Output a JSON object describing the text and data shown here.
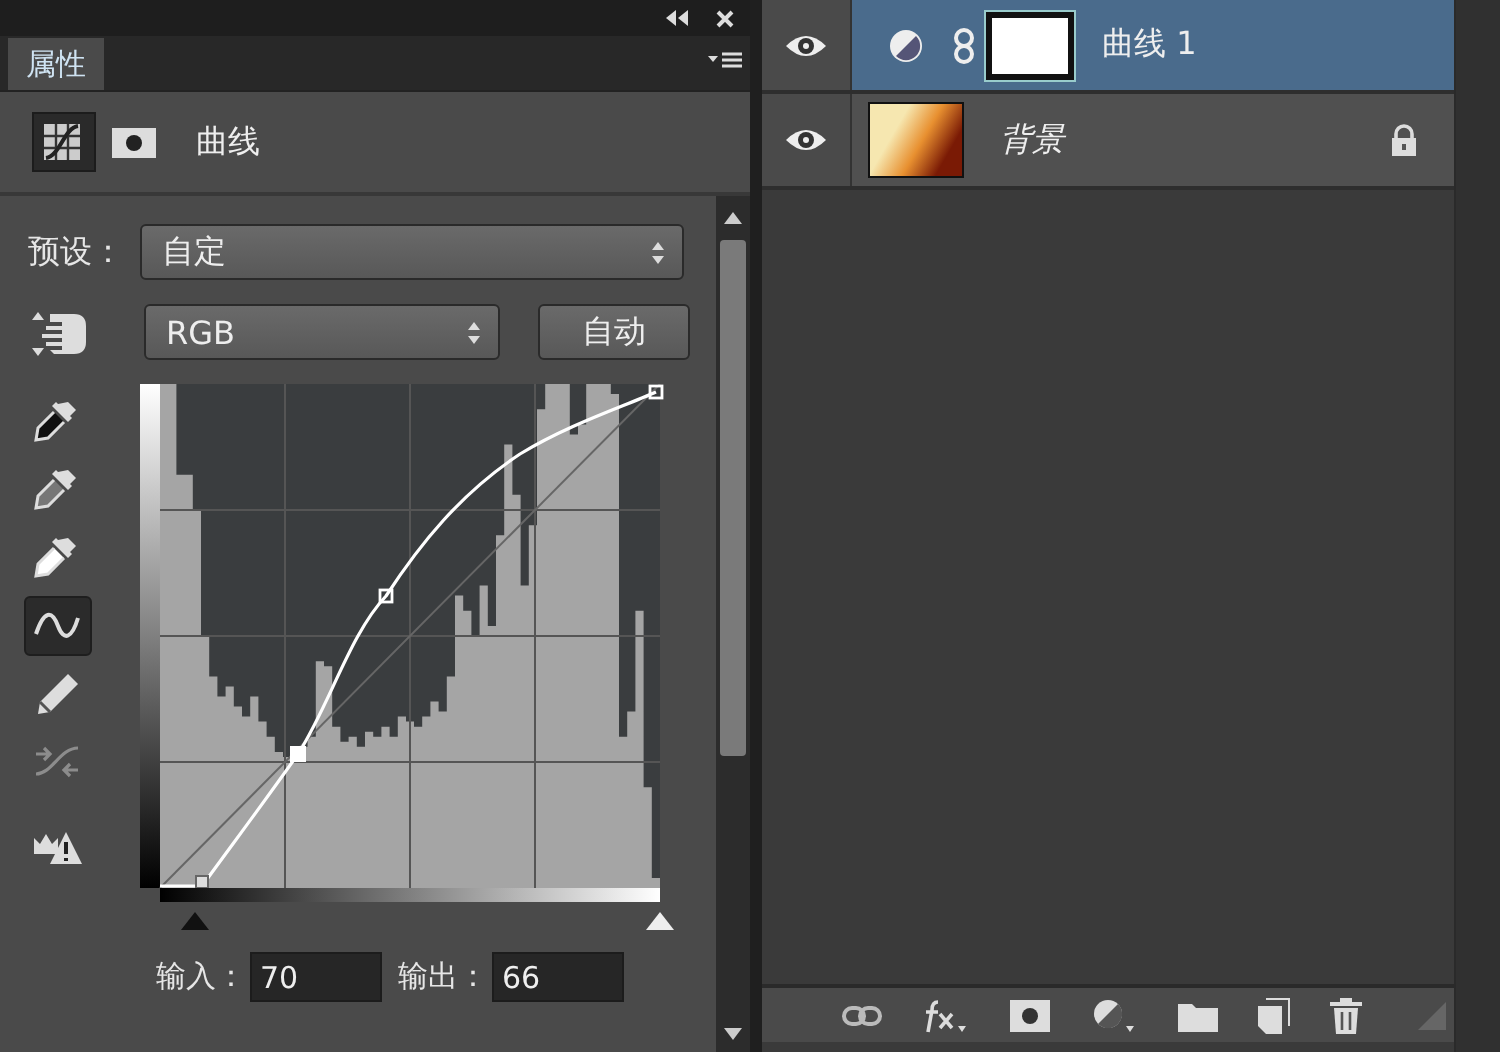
{
  "properties_panel": {
    "tab": {
      "label": "属性",
      "selected": true
    },
    "mode_buttons": [
      {
        "kind": "curves",
        "selected": true
      },
      {
        "kind": "mask",
        "selected": false
      }
    ],
    "title": "曲线",
    "preset": {
      "label": "预设：",
      "value": "自定"
    },
    "channel": {
      "value": "RGB"
    },
    "auto_button": "自动",
    "input_sliders": [
      {
        "kind": "shadow",
        "level": 0.07
      },
      {
        "kind": "highlight",
        "level": 1
      }
    ],
    "tools": [
      {
        "kind": "sample-shadows",
        "selected": false,
        "disabled": false
      },
      {
        "kind": "sample-midtones",
        "selected": false,
        "disabled": false
      },
      {
        "kind": "sample-highlights",
        "selected": false,
        "disabled": false
      },
      {
        "kind": "edit-points",
        "selected": true,
        "disabled": false
      },
      {
        "kind": "draw",
        "selected": false,
        "disabled": false
      },
      {
        "kind": "smooth",
        "selected": false,
        "disabled": true
      },
      {
        "kind": "clipping",
        "selected": false,
        "disabled": false
      }
    ],
    "input": {
      "label": "输入：",
      "value": "70"
    },
    "output": {
      "label": "输出：",
      "value": "66"
    }
  },
  "layers": [
    {
      "name": "曲线 1",
      "kind": "adjustment",
      "selected": true,
      "visible": true,
      "locked": false
    },
    {
      "name": "背景",
      "kind": "image",
      "selected": false,
      "visible": true,
      "locked": true
    }
  ]
}
